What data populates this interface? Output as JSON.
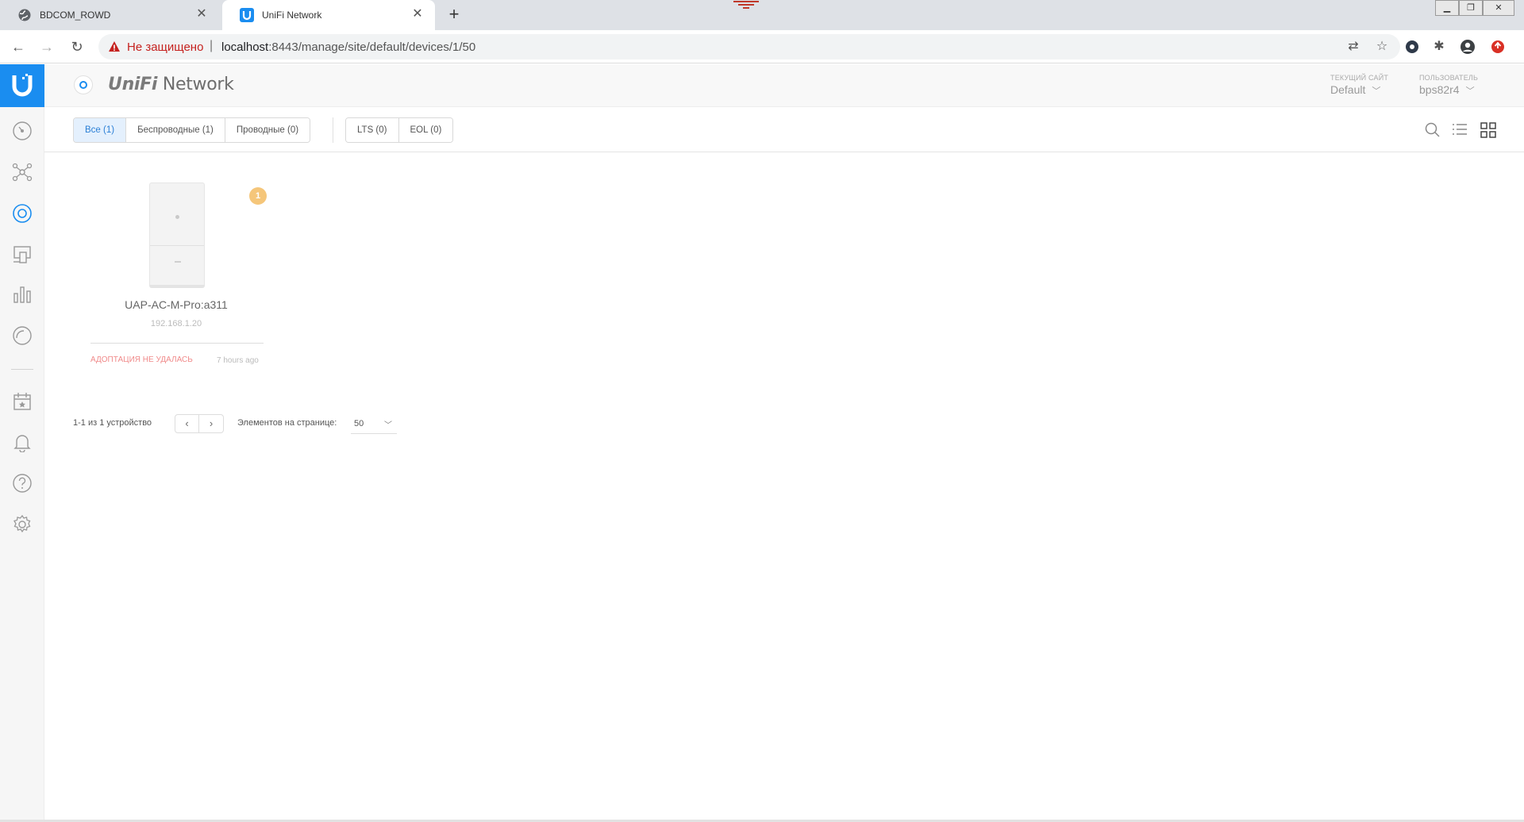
{
  "browser": {
    "tabs": [
      {
        "title": "BDCOM_ROWD",
        "icon": "globe-icon",
        "active": false
      },
      {
        "title": "UniFi Network",
        "icon": "unifi-favicon",
        "active": true
      }
    ],
    "address": {
      "security_label": "Не защищено",
      "url_host": "localhost",
      "url_rest": ":8443/manage/site/default/devices/1/50"
    }
  },
  "app": {
    "brand_prefix": "UniFi",
    "brand_suffix": "Network",
    "site": {
      "caption": "ТЕКУЩИЙ САЙТ",
      "value": "Default"
    },
    "user": {
      "caption": "ПОЛЬЗОВАТЕЛЬ",
      "value": "bps82r4"
    }
  },
  "filters": {
    "type_group": [
      "Все (1)",
      "Беспроводные (1)",
      "Проводные (0)"
    ],
    "support_group": [
      "LTS (0)",
      "EOL (0)"
    ],
    "active_index": 0
  },
  "device": {
    "name": "UAP-AC-M-Pro:a311",
    "ip": "192.168.1.20",
    "status": "АДОПТАЦИЯ НЕ УДАЛАСЬ",
    "last_seen": "7 hours ago",
    "badge": "1"
  },
  "pagination": {
    "count_label": "1-1 из 1 устройство",
    "per_page_label": "Элементов на странице:",
    "per_page_value": "50"
  },
  "colors": {
    "accent": "#1a8df0",
    "status_error": "#f08a8a",
    "badge": "#f5c67a"
  }
}
